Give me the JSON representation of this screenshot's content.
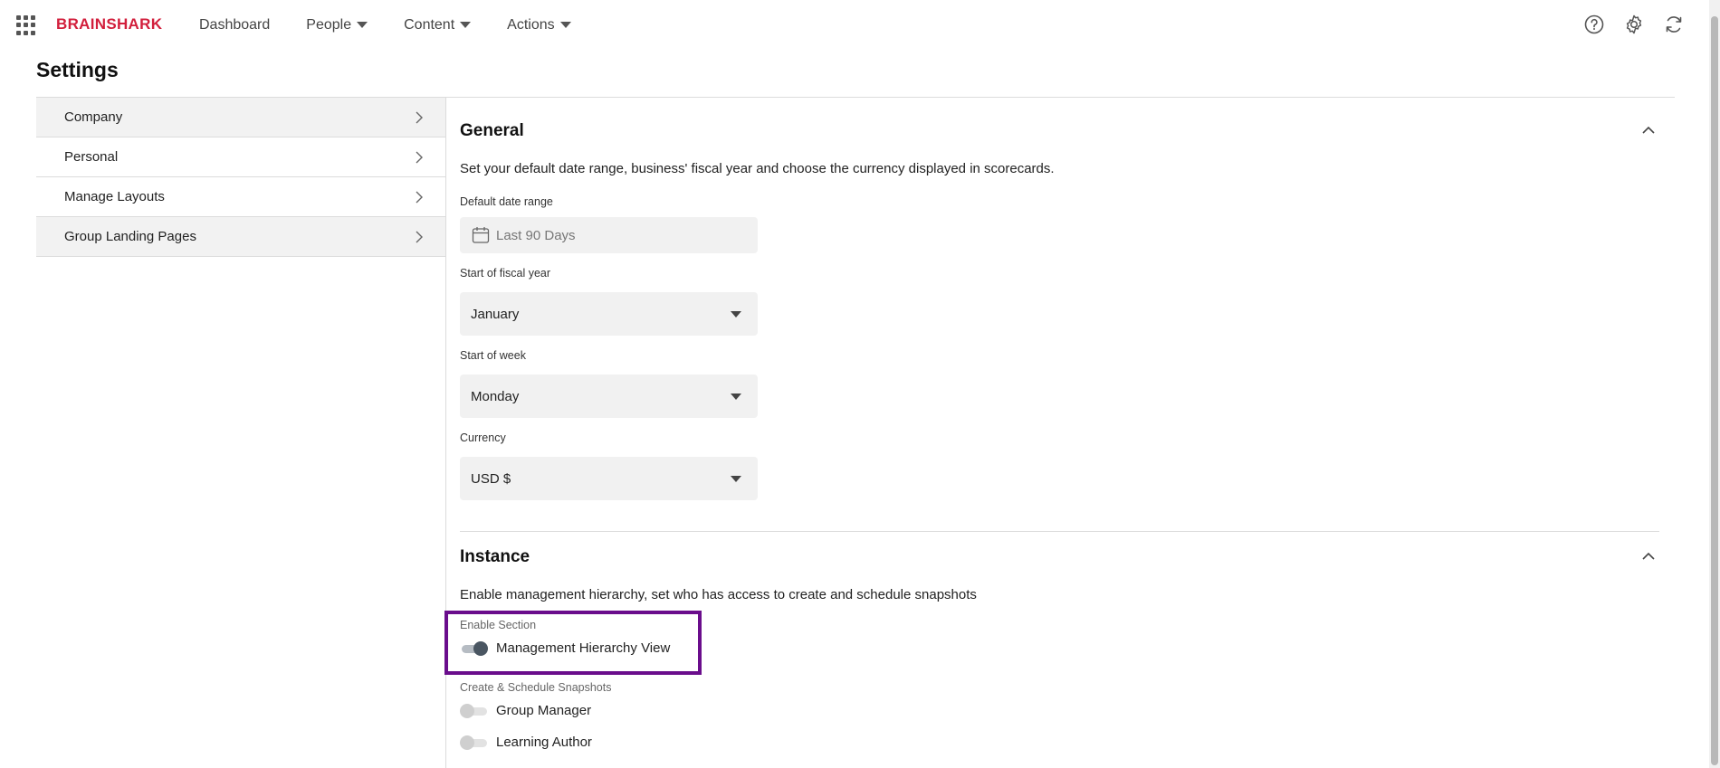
{
  "brand": {
    "name": "BRAINSHARK"
  },
  "nav": {
    "items": [
      {
        "label": "Dashboard",
        "has_caret": false
      },
      {
        "label": "People",
        "has_caret": true
      },
      {
        "label": "Content",
        "has_caret": true
      },
      {
        "label": "Actions",
        "has_caret": true
      }
    ]
  },
  "header_icons": [
    "help-icon",
    "gear-icon",
    "refresh-icon"
  ],
  "page": {
    "title": "Settings"
  },
  "sidebar": {
    "items": [
      {
        "label": "Company"
      },
      {
        "label": "Personal"
      },
      {
        "label": "Manage Layouts"
      },
      {
        "label": "Group Landing Pages"
      }
    ]
  },
  "general": {
    "title": "General",
    "description": "Set your default date range, business' fiscal year and choose the currency displayed in scorecards.",
    "date_range_label": "Default date range",
    "date_range_value": "Last 90 Days",
    "fiscal_label": "Start of fiscal year",
    "fiscal_value": "January",
    "week_label": "Start of week",
    "week_value": "Monday",
    "currency_label": "Currency",
    "currency_value": "USD $"
  },
  "instance": {
    "title": "Instance",
    "description": "Enable management hierarchy, set who has access to create and schedule snapshots",
    "enable_label": "Enable Section",
    "hierarchy_toggle": {
      "label": "Management Hierarchy View",
      "on": true
    },
    "snapshots_label": "Create & Schedule Snapshots",
    "snapshot_toggles": [
      {
        "label": "Group Manager",
        "on": false
      },
      {
        "label": "Learning Author",
        "on": false
      }
    ]
  },
  "colors": {
    "brand": "#d21f3c",
    "highlight_border": "#6a0d8c",
    "field_bg": "#f1f1f1",
    "toggle_on_knob": "#4a5662"
  }
}
